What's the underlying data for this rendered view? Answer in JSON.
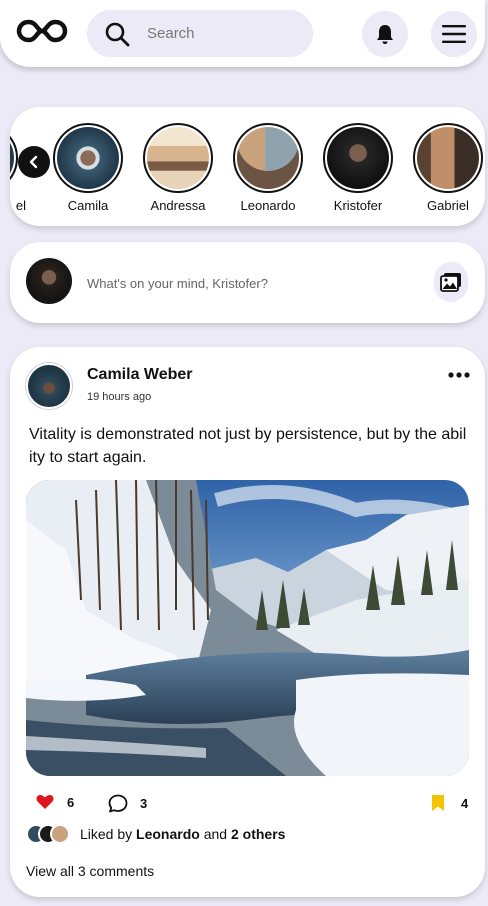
{
  "header": {
    "search_placeholder": "Search"
  },
  "stories": [
    {
      "name": "el",
      "avatar_color": "#2f4b5c"
    },
    {
      "name": "Camila",
      "avatar_color": "#3a5a6e"
    },
    {
      "name": "Andressa",
      "avatar_color": "#d9b58f"
    },
    {
      "name": "Leonardo",
      "avatar_color": "#a07a5c"
    },
    {
      "name": "Kristofer",
      "avatar_color": "#1a1a1a"
    },
    {
      "name": "Gabriel",
      "avatar_color": "#3a2e26"
    }
  ],
  "composer": {
    "placeholder": "What's on your mind, Kristofer?"
  },
  "post": {
    "author": "Camila Weber",
    "time": "19 hours ago",
    "caption": "Vitality is demonstrated not just by persistence, but by the ability to start again.",
    "likes": "6",
    "comments": "3",
    "saves": "4",
    "liked_prefix": "Liked by ",
    "liked_user": "Leonardo",
    "liked_and": " and ",
    "liked_others": "2 others",
    "view_all": "View all 3 comments"
  },
  "colors": {
    "background": "#eceaf6",
    "like": "#e0161f",
    "bookmark": "#f5c400"
  }
}
